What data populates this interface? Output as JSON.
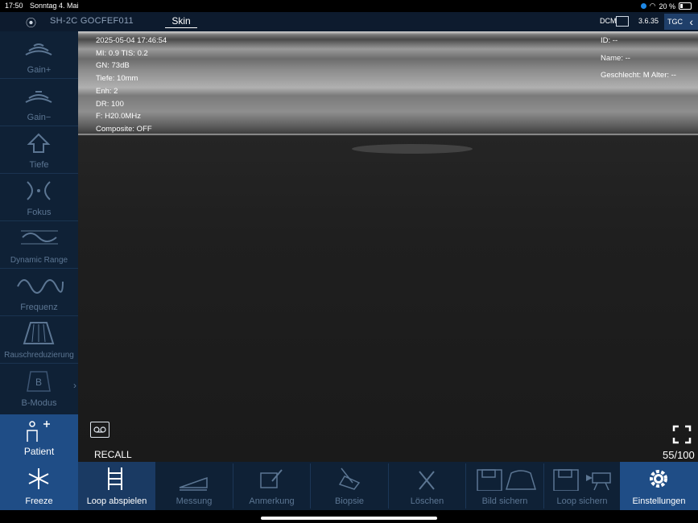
{
  "status_bar": {
    "time": "17:50",
    "date": "Sonntag 4. Mai",
    "battery": "20 %"
  },
  "top_bar": {
    "probe": "SH-2C GOCFEF011",
    "preset": "Skin",
    "dcm": "DCM",
    "version": "3.6.35",
    "tgc": "TGC"
  },
  "sidebar": {
    "items": [
      {
        "label": "Gain+",
        "icon": "gain-plus-icon"
      },
      {
        "label": "Gain−",
        "icon": "gain-minus-icon"
      },
      {
        "label": "Tiefe",
        "icon": "depth-icon"
      },
      {
        "label": "Fokus",
        "icon": "focus-icon"
      },
      {
        "label": "Dynamic Range",
        "icon": "dynamic-range-icon"
      },
      {
        "label": "Frequenz",
        "icon": "frequency-icon"
      },
      {
        "label": "Rauschreduzierung",
        "icon": "noise-reduction-icon"
      },
      {
        "label": "B-Modus",
        "icon": "b-mode-icon"
      }
    ],
    "patient_label": "Patient"
  },
  "image_info": {
    "datetime": "2025-05-04 17:46:54",
    "mi_tis": "MI: 0.9  TIS: 0.2",
    "gn": "GN: 73dB",
    "depth": "Tiefe: 10mm",
    "enh": "Enh: 2",
    "dr": "DR: 100",
    "freq": "F: H20.0MHz",
    "composite": "Composite: OFF"
  },
  "patient_info": {
    "id": "ID: --",
    "name": "Name: --",
    "gender_age": "Geschlecht: M  Alter: --"
  },
  "recall_label": "RECALL",
  "frame_counter": "55/100",
  "bottom_bar": {
    "freeze": "Freeze",
    "loop": "Loop abspielen",
    "measure": "Messung",
    "annotation": "Anmerkung",
    "biopsy": "Biopsie",
    "delete": "Löschen",
    "save_image": "Bild sichern",
    "save_loop": "Loop sichern",
    "settings": "Einstellungen"
  },
  "colors": {
    "accent": "#1f4d86",
    "panel": "#0f2136",
    "inactive_text": "#5c7693"
  }
}
